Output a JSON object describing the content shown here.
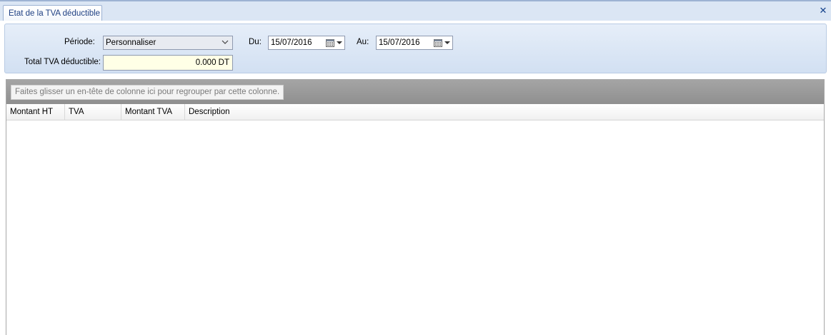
{
  "tab": {
    "title": "Etat de la TVA déductible"
  },
  "filters": {
    "period_label": "Période:",
    "period_value": "Personnaliser",
    "from_label": "Du:",
    "from_value": "15/07/2016",
    "to_label": "Au:",
    "to_value": "15/07/2016",
    "total_label": "Total TVA déductible:",
    "total_value": "0.000 DT"
  },
  "grid": {
    "group_hint": "Faites glisser un en-tête de colonne ici pour regrouper par cette colonne.",
    "columns": [
      "Montant HT",
      "TVA",
      "Montant TVA",
      "Description"
    ]
  },
  "icons": {
    "close": "close-icon",
    "calendar": "calendar-icon",
    "dropdown": "chevron-down-icon"
  },
  "colors": {
    "tab_text": "#1e3f82",
    "panel": "#d2e0f2",
    "total_field": "#ffffe6",
    "group_panel": "#999999"
  }
}
